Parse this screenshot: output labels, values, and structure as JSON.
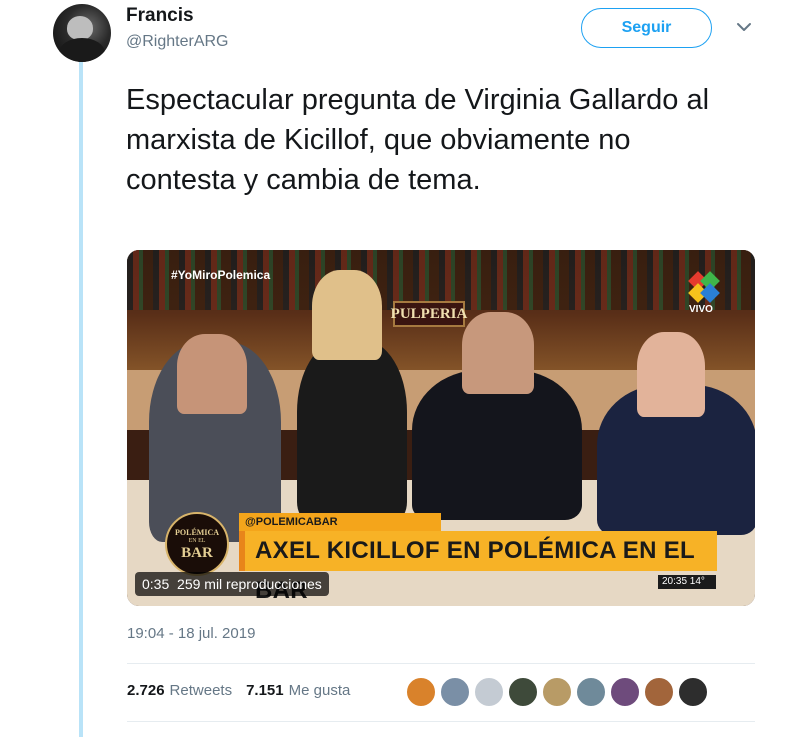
{
  "author": {
    "display_name": "Francis",
    "handle": "@RighterARG"
  },
  "follow_button": {
    "label": "Seguir"
  },
  "tweet": {
    "text": "Espectacular pregunta de Virginia Gallardo al marxista de Kicillof, que obviamente no contesta y cambia de tema.",
    "timestamp": "19:04 - 18 jul. 2019"
  },
  "video": {
    "duration": "0:35",
    "views": "259 mil reproducciones",
    "overlay": {
      "hashtag": "#YoMiroPolemica",
      "sign": "PULPERIA",
      "channel_live": "VIVO",
      "show_logo_line1": "POLÉMICA",
      "show_logo_line2": "EN EL",
      "show_logo_line3": "BAR",
      "tag": "@POLEMICABAR",
      "headline": "AXEL KICILLOF EN POLÉMICA EN EL BAR",
      "clock": "20:35  14°"
    }
  },
  "stats": {
    "retweets_count": "2.726",
    "retweets_label": "Retweets",
    "likes_count": "7.151",
    "likes_label": "Me gusta"
  },
  "likers": [
    "#d9822b",
    "#7a8fa6",
    "#c4cbd3",
    "#3e4a3a",
    "#b89b66",
    "#6f8a9a",
    "#6e4b7c",
    "#a2653b",
    "#2d2d2d"
  ],
  "colors": {
    "accent": "#1da1f2",
    "thread_line": "#b9e3f8",
    "muted": "#657786"
  },
  "icons": {
    "caret": "chevron-down-icon"
  }
}
